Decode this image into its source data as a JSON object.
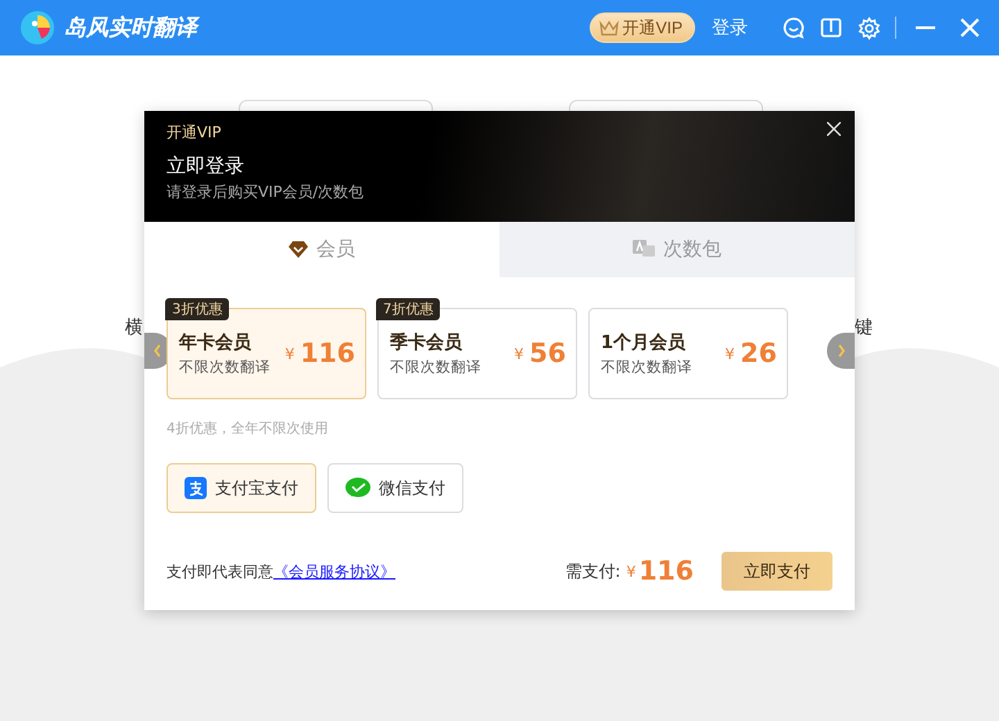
{
  "titlebar": {
    "title": "岛风实时翻译",
    "vip_button": "开通VIP",
    "login": "登录"
  },
  "background": {
    "left_text": "横",
    "right_text": "键"
  },
  "modal": {
    "caption": "开通VIP",
    "heading": "立即登录",
    "subtitle": "请登录后购买VIP会员/次数包",
    "tabs": [
      {
        "label": "会员",
        "kind": "member",
        "selected": true
      },
      {
        "label": "次数包",
        "kind": "count",
        "selected": false
      }
    ],
    "plans": [
      {
        "tag": "3折优惠",
        "name": "年卡会员",
        "desc": "不限次数翻译",
        "currency": "¥",
        "price": "116",
        "selected": true
      },
      {
        "tag": "7折优惠",
        "name": "季卡会员",
        "desc": "不限次数翻译",
        "currency": "¥",
        "price": "56",
        "selected": false
      },
      {
        "name": "1个月会员",
        "desc": "不限次数翻译",
        "currency": "¥",
        "price": "26",
        "selected": false
      }
    ],
    "plan_note": "4折优惠，全年不限次使用",
    "payment_methods": [
      {
        "label": "支付宝支付",
        "kind": "alipay",
        "selected": true
      },
      {
        "label": "微信支付",
        "kind": "wechat",
        "selected": false
      }
    ],
    "agreement": {
      "text": "支付即代表同意",
      "link": "《会员服务协议》"
    },
    "total": {
      "label": "需支付:",
      "currency": "¥",
      "amount": "116"
    },
    "pay_button": "立即支付"
  }
}
